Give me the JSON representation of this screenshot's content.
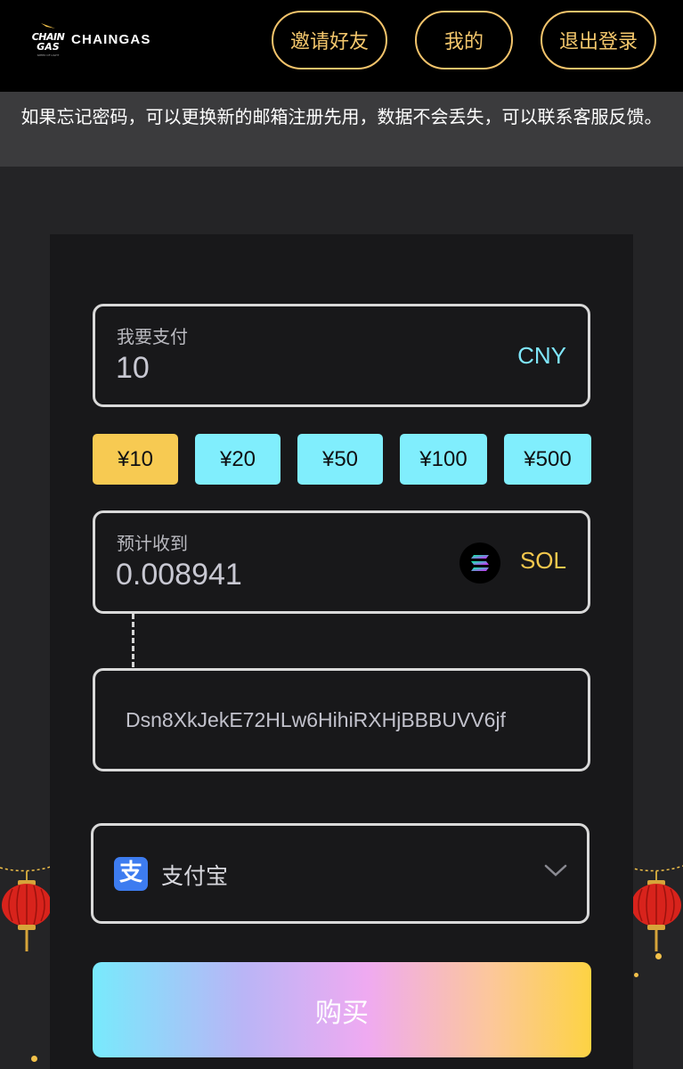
{
  "header": {
    "brand": "CHAINGAS",
    "logo_line1": "CHAIN",
    "logo_line2": "GAS",
    "logo_tagline": "SPEED OF LIGHT",
    "buttons": {
      "invite": "邀请好友",
      "mine": "我的",
      "logout": "退出登录"
    },
    "accent_color": "#f2c36b"
  },
  "notice": {
    "text": "如果忘记密码，可以更换新的邮箱注册先用，数据不会丢失，可以联系客服反馈。"
  },
  "pay": {
    "label": "我要支付",
    "value": "10",
    "currency": "CNY"
  },
  "quick_amounts": [
    {
      "label": "¥10",
      "active": true
    },
    {
      "label": "¥20",
      "active": false
    },
    {
      "label": "¥50",
      "active": false
    },
    {
      "label": "¥100",
      "active": false
    },
    {
      "label": "¥500",
      "active": false
    }
  ],
  "receive": {
    "label": "预计收到",
    "value": "0.008941",
    "currency": "SOL",
    "icon": "solana-icon"
  },
  "wallet": {
    "address": "Dsn8XkJekE72HLw6HihiRXHjBBBUVV6jf"
  },
  "payment_method": {
    "label": "支付宝",
    "icon": "alipay-icon",
    "icon_glyph": "支"
  },
  "buy_button": {
    "label": "购买"
  }
}
